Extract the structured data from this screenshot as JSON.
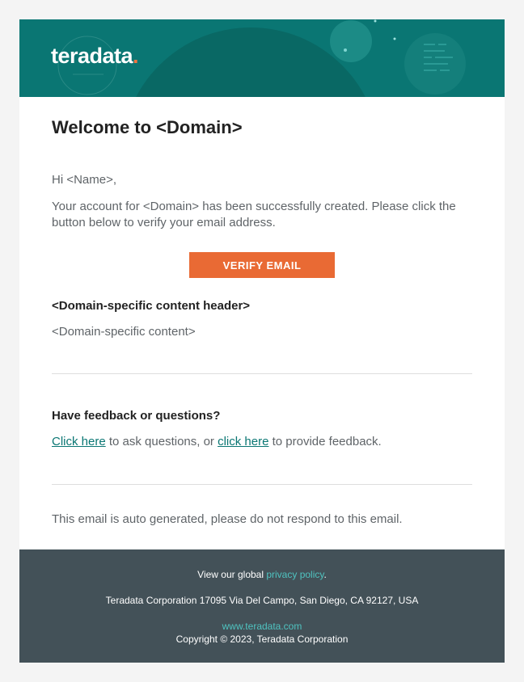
{
  "brand": {
    "logo_text": "teradata",
    "logo_dot": ".",
    "accent_color": "#0a7673",
    "button_color": "#e96a34",
    "footer_color": "#435158"
  },
  "email": {
    "title": "Welcome to <Domain>",
    "greeting": "Hi <Name>,",
    "body": "Your account for <Domain> has been successfully created. Please click the button below to verify your email address.",
    "verify_button": "VERIFY EMAIL",
    "domain_header": "<Domain-specific content header>",
    "domain_content": "<Domain-specific content>",
    "feedback_header": "Have feedback or questions?",
    "feedback_link1": "Click here",
    "feedback_text1": " to ask questions, or ",
    "feedback_link2": "click here",
    "feedback_text2": " to provide feedback.",
    "autogen_notice": "This email is auto generated, please do not respond to this email."
  },
  "footer": {
    "privacy_prefix": "View our global ",
    "privacy_link": "privacy policy",
    "privacy_suffix": ".",
    "address": "Teradata Corporation 17095 Via Del Campo, San Diego, CA 92127, USA",
    "website": "www.teradata.com",
    "copyright": "Copyright © 2023, Teradata Corporation"
  }
}
